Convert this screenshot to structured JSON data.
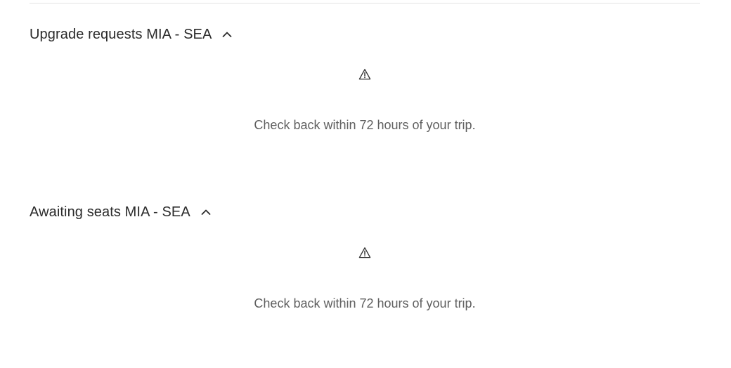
{
  "sections": [
    {
      "title": "Upgrade requests MIA - SEA",
      "expanded_icon": "chevron-up-icon",
      "warning_icon": "warning-icon",
      "message": "Check back within 72 hours of your trip."
    },
    {
      "title": "Awaiting seats MIA - SEA",
      "expanded_icon": "chevron-up-icon",
      "warning_icon": "warning-icon",
      "message": "Check back within 72 hours of your trip."
    }
  ],
  "colors": {
    "text": "#2b2b2b",
    "muted_text": "#5f5f5f",
    "divider": "#e3e3e3"
  }
}
